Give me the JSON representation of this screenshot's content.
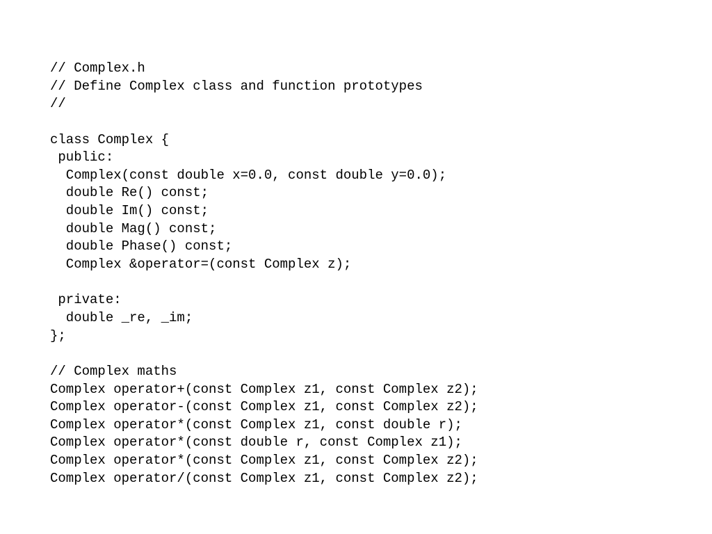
{
  "code": {
    "lines": [
      "// Complex.h",
      "// Define Complex class and function prototypes",
      "//",
      "",
      "class Complex {",
      " public:",
      "  Complex(const double x=0.0, const double y=0.0);",
      "  double Re() const;",
      "  double Im() const;",
      "  double Mag() const;",
      "  double Phase() const;",
      "  Complex &operator=(const Complex z);",
      "",
      " private:",
      "  double _re, _im;",
      "};",
      "",
      "// Complex maths",
      "Complex operator+(const Complex z1, const Complex z2);",
      "Complex operator-(const Complex z1, const Complex z2);",
      "Complex operator*(const Complex z1, const double r);",
      "Complex operator*(const double r, const Complex z1);",
      "Complex operator*(const Complex z1, const Complex z2);",
      "Complex operator/(const Complex z1, const Complex z2);"
    ]
  }
}
